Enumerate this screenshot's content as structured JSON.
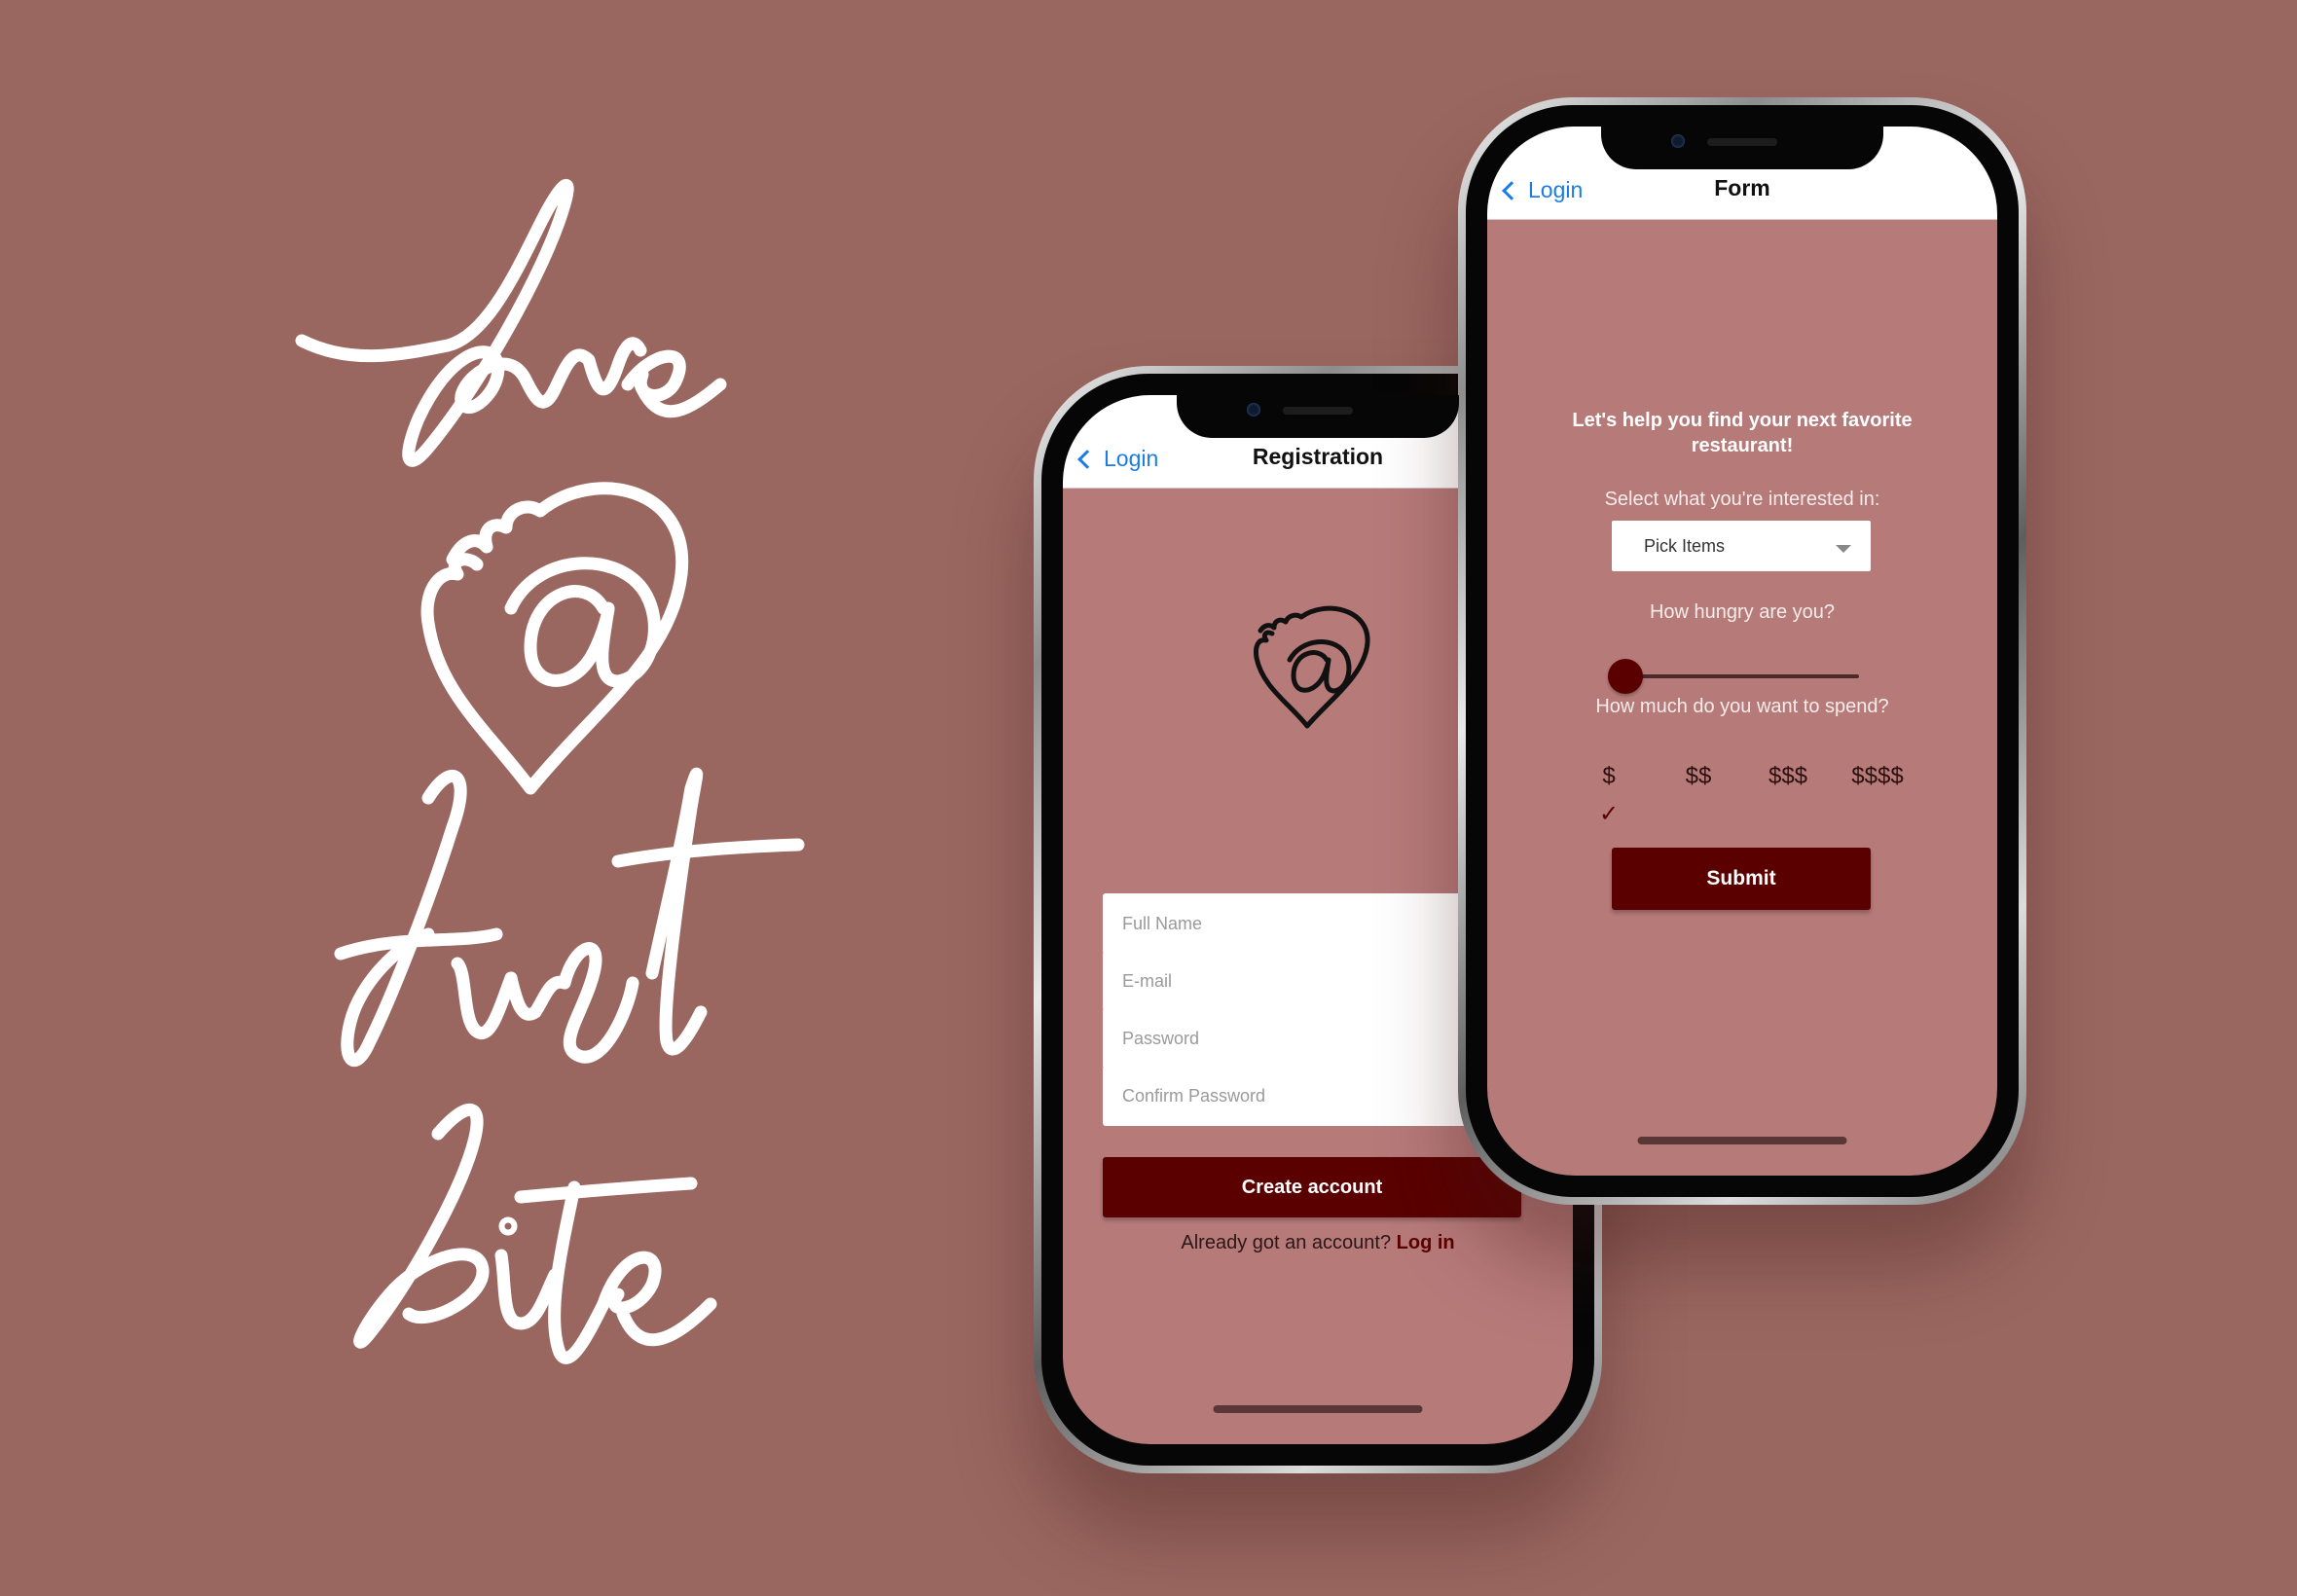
{
  "brand": {
    "lettering": "love @ first bite"
  },
  "registration_screen": {
    "nav": {
      "back_label": "Login",
      "title": "Registration"
    },
    "fields": {
      "full_name_placeholder": "Full Name",
      "email_placeholder": "E-mail",
      "password_placeholder": "Password",
      "confirm_password_placeholder": "Confirm Password"
    },
    "create_account_label": "Create account",
    "login_prompt": "Already got an account?",
    "login_link": "Log in"
  },
  "form_screen": {
    "nav": {
      "back_label": "Login",
      "title": "Form"
    },
    "heading": "Let's help you find your next favorite restaurant!",
    "interests_label": "Select what you're interested in:",
    "interests_select_value": "Pick Items",
    "hunger_label": "How hungry are you?",
    "hunger_level": 0,
    "spend_label": "How much do you want to spend?",
    "price_options": [
      "$",
      "$$",
      "$$$",
      "$$$$"
    ],
    "selected_price": "$",
    "submit_label": "Submit"
  },
  "colors": {
    "background": "#9a6760",
    "screen_background": "#b67a79",
    "accent": "#5a0000",
    "link": "#1a7de6"
  },
  "icons": [
    "chevron-left-icon",
    "heart-logo-icon",
    "dropdown-caret-icon",
    "checkmark-icon"
  ]
}
